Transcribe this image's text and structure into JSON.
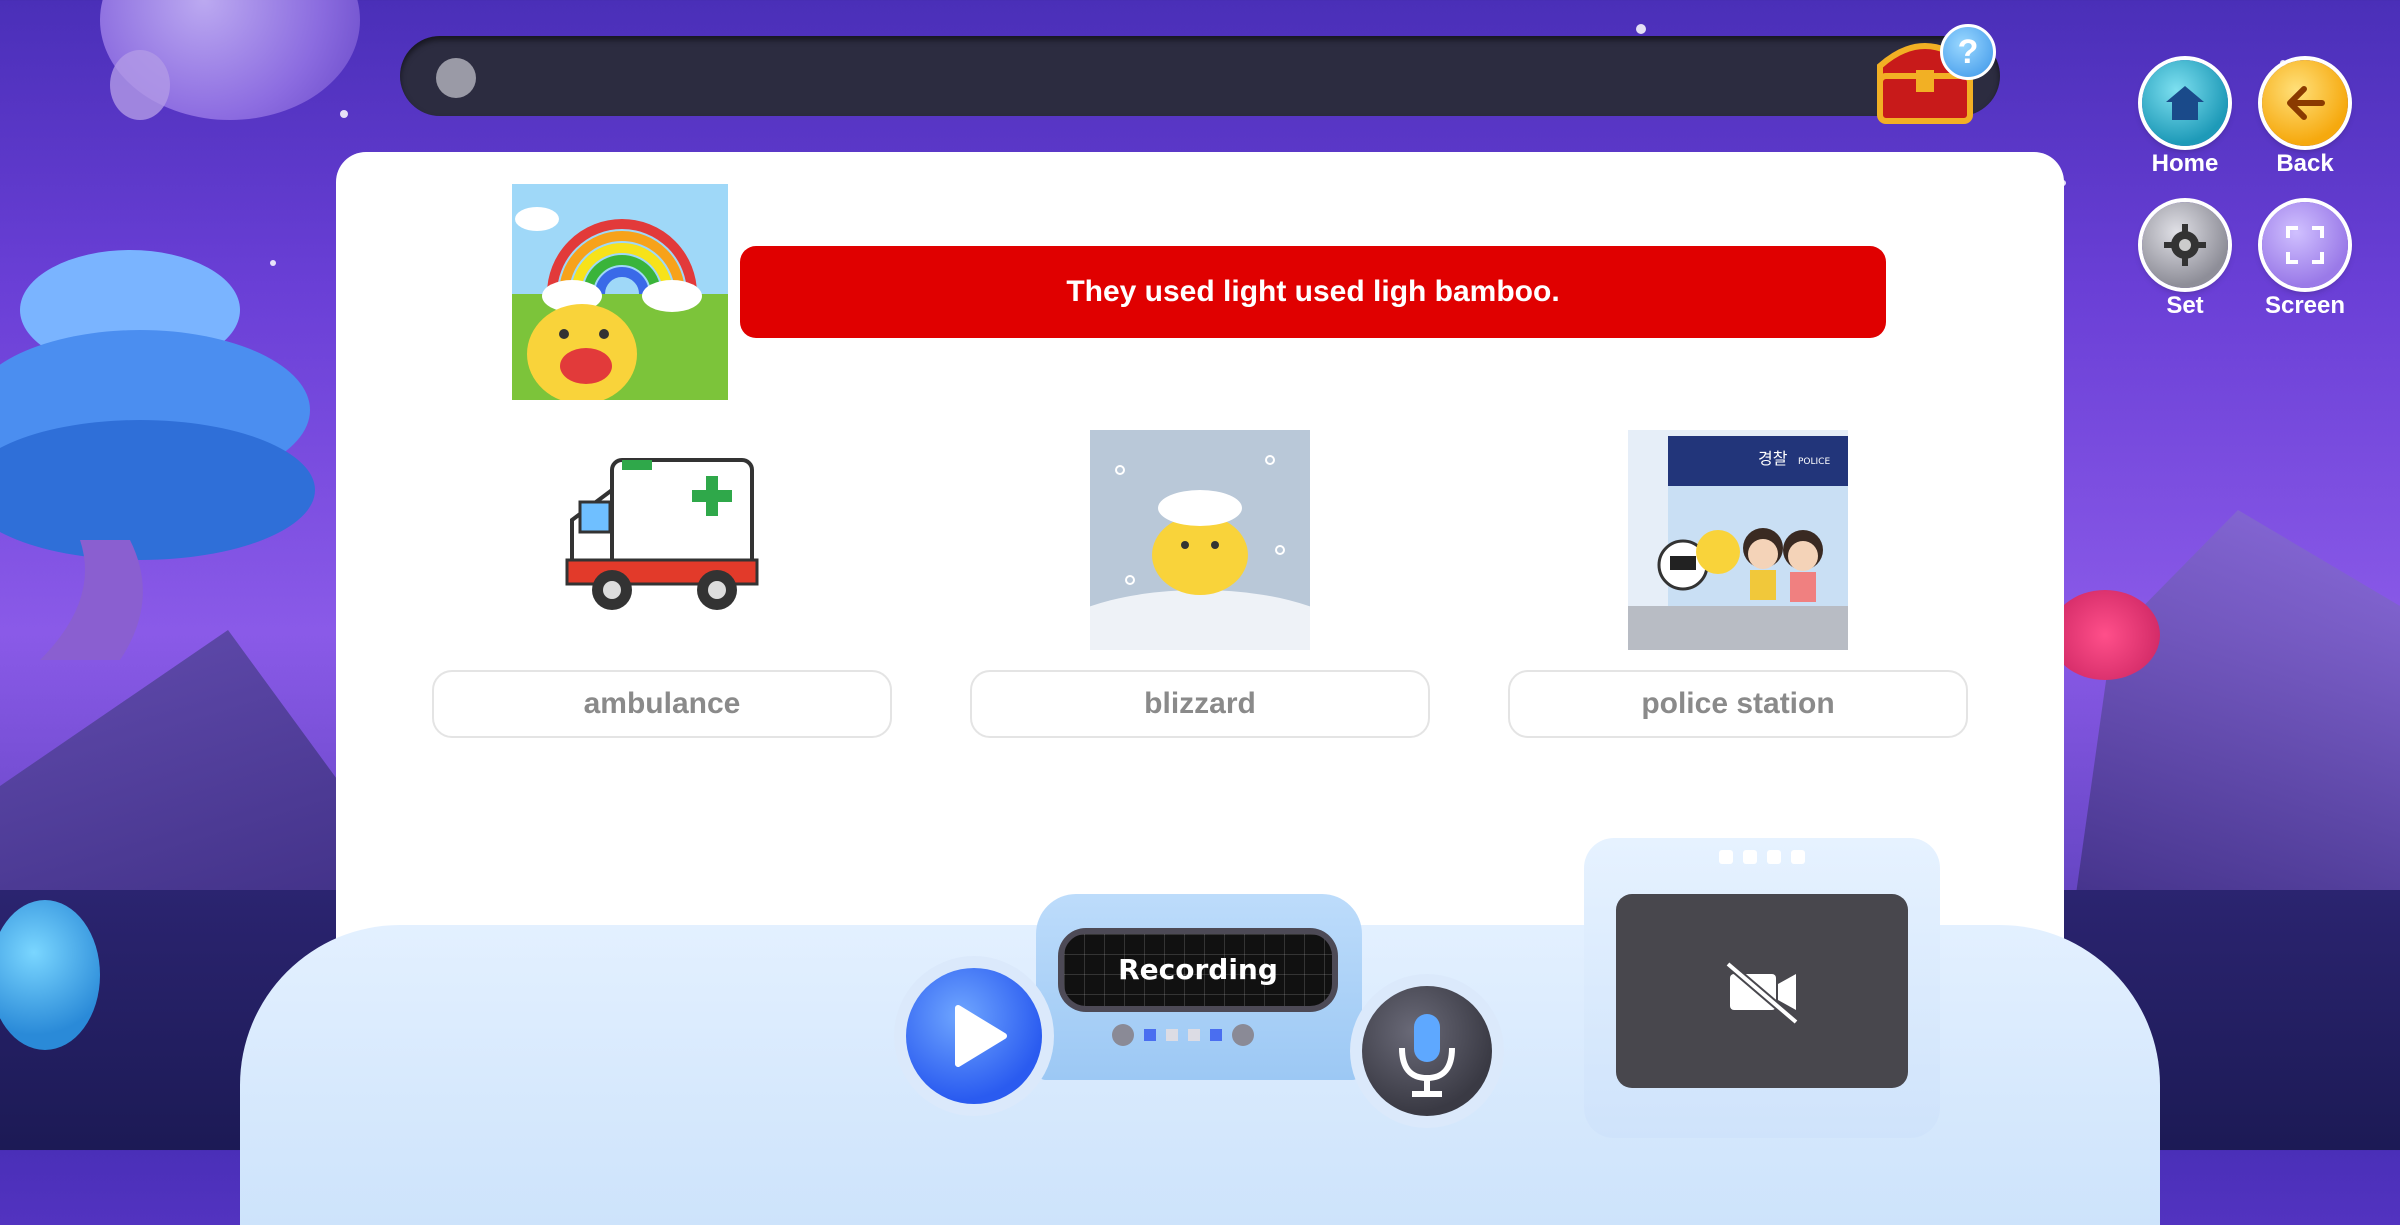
{
  "progress": {
    "value": 0.0
  },
  "question": {
    "sentence": "They used light used ligh bamboo.",
    "banner_color": "#e00000"
  },
  "options": [
    {
      "label": "ambulance",
      "icon": "ambulance-image"
    },
    {
      "label": "blizzard",
      "icon": "blizzard-image"
    },
    {
      "label": "police station",
      "icon": "police-station-image",
      "sign_text": "경찰",
      "sign_sub": "POLICE"
    }
  ],
  "console": {
    "status": "Recording",
    "pager": {
      "total": 4,
      "active": [
        0,
        3
      ]
    }
  },
  "nav": {
    "home": "Home",
    "back": "Back",
    "set": "Set",
    "screen": "Screen"
  },
  "help": "?",
  "colors": {
    "accent_blue": "#2a5bf0",
    "banner_red": "#e00000",
    "home_teal": "#1e9ab8",
    "back_orange": "#f6a90e"
  }
}
